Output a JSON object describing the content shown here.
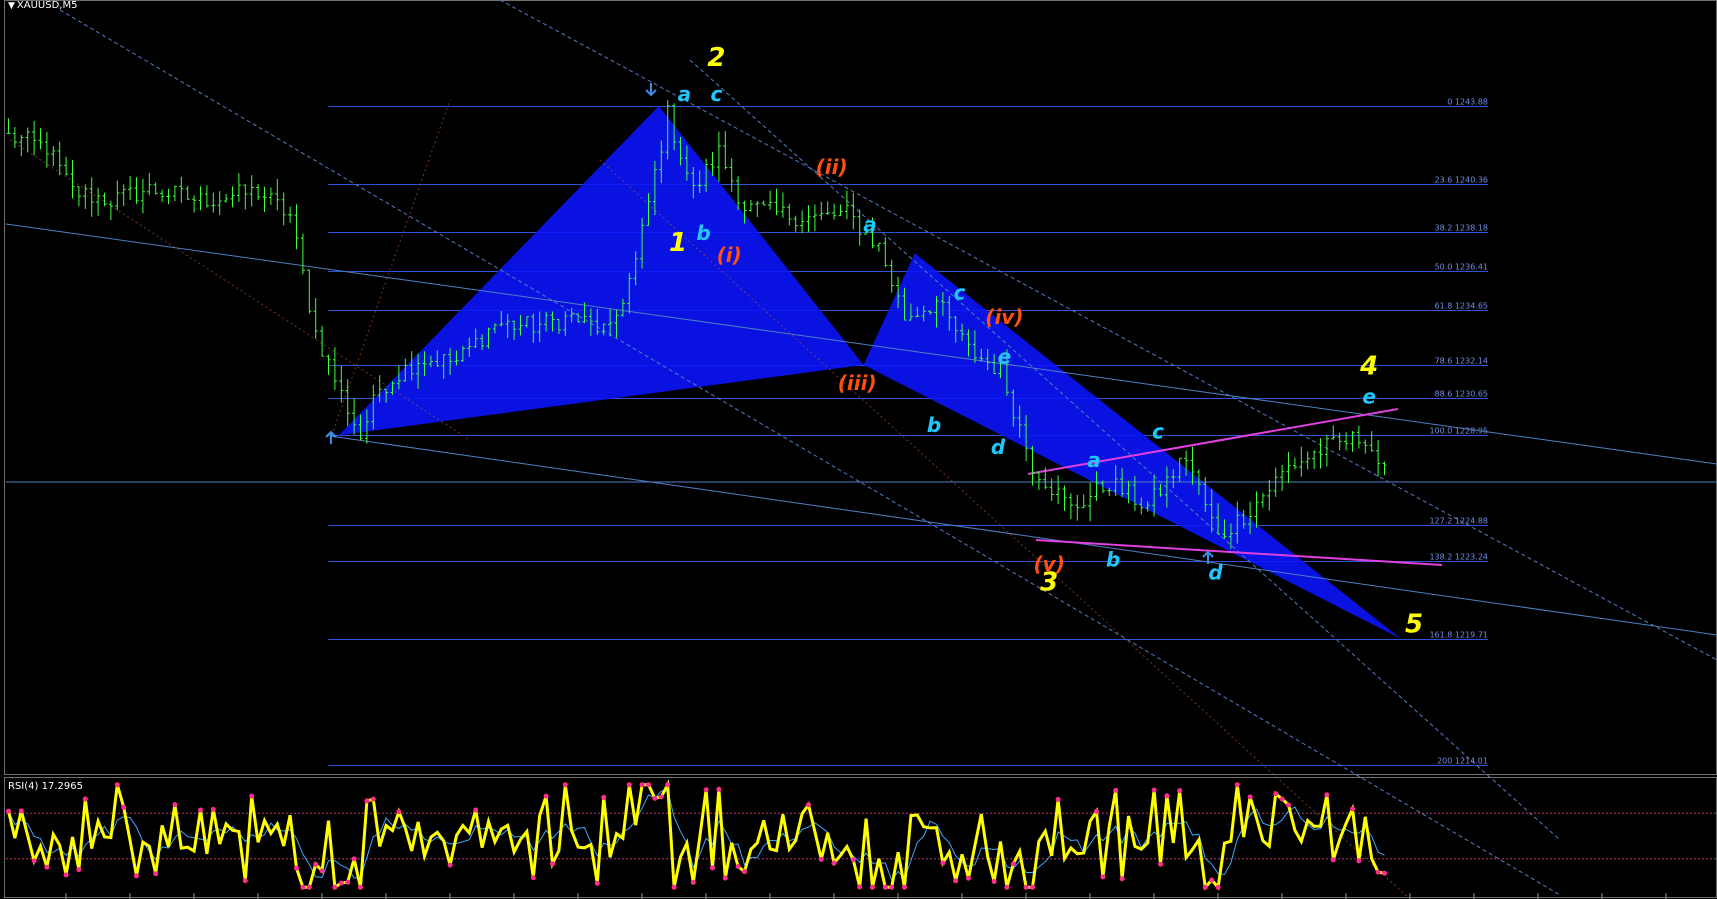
{
  "window": {
    "symbol_title": "XAUUSD,M5",
    "indicator_title": "RSI(4) 17.2965"
  },
  "colors": {
    "background": "#000000",
    "candles": "#3cff3c",
    "fib_lines": "#2e54d6",
    "fib_text": "#6f8fe6",
    "triangle_fill": "#0a14ff",
    "channel_lines": "#4f7fc4",
    "wedge_lines": "#e040e0",
    "wave_major": "#ffff00",
    "wave_minor": "#1ec8ff",
    "wave_sub": "#ff5010",
    "rsi_main": "#ffff00",
    "rsi_dots": "#ff2e8a",
    "rsi_signal": "#3aa8ff"
  },
  "chart_data": {
    "type": "candlestick",
    "symbol": "XAUUSD",
    "timeframe": "M5",
    "price_path": [
      {
        "bar": 0,
        "price": 1242.5
      },
      {
        "bar": 6,
        "price": 1242.0
      },
      {
        "bar": 10,
        "price": 1240.0
      },
      {
        "bar": 16,
        "price": 1239.6
      },
      {
        "bar": 22,
        "price": 1240.1
      },
      {
        "bar": 30,
        "price": 1239.6
      },
      {
        "bar": 39,
        "price": 1240.0
      },
      {
        "bar": 44,
        "price": 1238.9
      },
      {
        "bar": 48,
        "price": 1233.6
      },
      {
        "bar": 52,
        "price": 1230.8
      },
      {
        "bar": 55,
        "price": 1228.9
      },
      {
        "bar": 58,
        "price": 1231.1
      },
      {
        "bar": 64,
        "price": 1232.4
      },
      {
        "bar": 70,
        "price": 1232.3
      },
      {
        "bar": 76,
        "price": 1234.0
      },
      {
        "bar": 82,
        "price": 1233.9
      },
      {
        "bar": 88,
        "price": 1234.3
      },
      {
        "bar": 94,
        "price": 1233.6
      },
      {
        "bar": 98,
        "price": 1236.8
      },
      {
        "bar": 103,
        "price": 1243.5
      },
      {
        "bar": 107,
        "price": 1240.0
      },
      {
        "bar": 111,
        "price": 1241.8
      },
      {
        "bar": 115,
        "price": 1239.3
      },
      {
        "bar": 120,
        "price": 1239.0
      },
      {
        "bar": 126,
        "price": 1238.8
      },
      {
        "bar": 131,
        "price": 1239.0
      },
      {
        "bar": 136,
        "price": 1237.5
      },
      {
        "bar": 140,
        "price": 1234.3
      },
      {
        "bar": 145,
        "price": 1235.0
      },
      {
        "bar": 150,
        "price": 1232.8
      },
      {
        "bar": 155,
        "price": 1231.9
      },
      {
        "bar": 160,
        "price": 1227.6
      },
      {
        "bar": 166,
        "price": 1225.6
      },
      {
        "bar": 172,
        "price": 1226.8
      },
      {
        "bar": 178,
        "price": 1225.7
      },
      {
        "bar": 184,
        "price": 1228.0
      },
      {
        "bar": 189,
        "price": 1224.3
      },
      {
        "bar": 194,
        "price": 1225.6
      },
      {
        "bar": 200,
        "price": 1227.5
      },
      {
        "bar": 206,
        "price": 1228.4
      },
      {
        "bar": 212,
        "price": 1228.9
      },
      {
        "bar": 215,
        "price": 1227.2
      }
    ],
    "fibonacci": [
      {
        "level": "0",
        "price": "1243.88"
      },
      {
        "level": "23.6",
        "price": "1240.36"
      },
      {
        "level": "38.2",
        "price": "1238.18"
      },
      {
        "level": "50.0",
        "price": "1236.41"
      },
      {
        "level": "61.8",
        "price": "1234.65"
      },
      {
        "level": "78.6",
        "price": "1232.14"
      },
      {
        "level": "88.6",
        "price": "1230.65"
      },
      {
        "level": "100.0",
        "price": "1228.95"
      },
      {
        "level": "127.2",
        "price": "1224.88"
      },
      {
        "level": "138.2",
        "price": "1223.24"
      },
      {
        "level": "161.8",
        "price": "1219.71"
      },
      {
        "level": "200",
        "price": "1214.01"
      }
    ],
    "wave_labels": [
      {
        "text": "1",
        "bar": 105,
        "price": 1237.3,
        "style": "major"
      },
      {
        "text": "2",
        "bar": 111,
        "price": 1245.7,
        "style": "major"
      },
      {
        "text": "3",
        "bar": 163,
        "price": 1221.9,
        "style": "major"
      },
      {
        "text": "4",
        "bar": 213,
        "price": 1231.7,
        "style": "major"
      },
      {
        "text": "5",
        "bar": 220,
        "price": 1220.0,
        "style": "major"
      },
      {
        "text": "a",
        "bar": 106,
        "price": 1244.1,
        "style": "minor"
      },
      {
        "text": "c",
        "bar": 111,
        "price": 1244.1,
        "style": "minor"
      },
      {
        "text": "b",
        "bar": 109,
        "price": 1237.8,
        "style": "minor"
      },
      {
        "text": "a",
        "bar": 135,
        "price": 1238.2,
        "style": "minor"
      },
      {
        "text": "c",
        "bar": 149,
        "price": 1235.1,
        "style": "minor"
      },
      {
        "text": "e",
        "bar": 156,
        "price": 1232.2,
        "style": "minor"
      },
      {
        "text": "b",
        "bar": 145,
        "price": 1229.1,
        "style": "minor"
      },
      {
        "text": "d",
        "bar": 155,
        "price": 1228.1,
        "style": "minor"
      },
      {
        "text": "a",
        "bar": 170,
        "price": 1227.5,
        "style": "minor"
      },
      {
        "text": "c",
        "bar": 180,
        "price": 1228.8,
        "style": "minor"
      },
      {
        "text": "b",
        "bar": 173,
        "price": 1223.0,
        "style": "minor"
      },
      {
        "text": "d",
        "bar": 189,
        "price": 1222.4,
        "style": "minor"
      },
      {
        "text": "e",
        "bar": 213,
        "price": 1230.4,
        "style": "minor"
      },
      {
        "text": "(i)",
        "bar": 113,
        "price": 1236.8,
        "style": "sub"
      },
      {
        "text": "(ii)",
        "bar": 129,
        "price": 1240.8,
        "style": "sub"
      },
      {
        "text": "(iii)",
        "bar": 133,
        "price": 1231.0,
        "style": "sub"
      },
      {
        "text": "(iv)",
        "bar": 156,
        "price": 1234.0,
        "style": "sub"
      },
      {
        "text": "(v)",
        "bar": 163,
        "price": 1222.8,
        "style": "sub"
      }
    ],
    "harmonic_pattern": [
      {
        "bar": 52,
        "price": 1228.95
      },
      {
        "bar": 102,
        "price": 1243.88
      },
      {
        "bar": 134,
        "price": 1232.14
      },
      {
        "bar": 142,
        "price": 1237.2
      },
      {
        "bar": 218,
        "price": 1219.71
      }
    ],
    "rsi": {
      "period": 4,
      "value": 17.2965,
      "levels": [
        70,
        30
      ]
    }
  }
}
